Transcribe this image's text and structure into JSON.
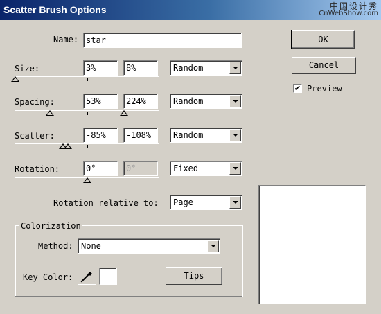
{
  "window": {
    "title": "Scatter Brush Options",
    "watermark_cn": "中国设计秀",
    "watermark_url": "CnWebShow.com"
  },
  "name": {
    "label": "Name:",
    "value": "star"
  },
  "size": {
    "label": "Size:",
    "min": "3%",
    "max": "8%",
    "mode": "Random"
  },
  "spacing": {
    "label": "Spacing:",
    "min": "53%",
    "max": "224%",
    "mode": "Random"
  },
  "scatter": {
    "label": "Scatter:",
    "min": "-85%",
    "max": "-108%",
    "mode": "Random"
  },
  "rotation": {
    "label": "Rotation:",
    "min": "0°",
    "max": "0°",
    "mode": "Fixed"
  },
  "rotation_relative": {
    "label": "Rotation relative to:",
    "value": "Page"
  },
  "colorization": {
    "title": "Colorization",
    "method_label": "Method:",
    "method_value": "None",
    "key_color_label": "Key Color:",
    "tips_label": "Tips"
  },
  "buttons": {
    "ok": "OK",
    "cancel": "Cancel"
  },
  "preview": {
    "label": "Preview",
    "checked": true,
    "check_mark": "✔"
  },
  "icons": {
    "eyedropper": "eyedropper-icon"
  }
}
